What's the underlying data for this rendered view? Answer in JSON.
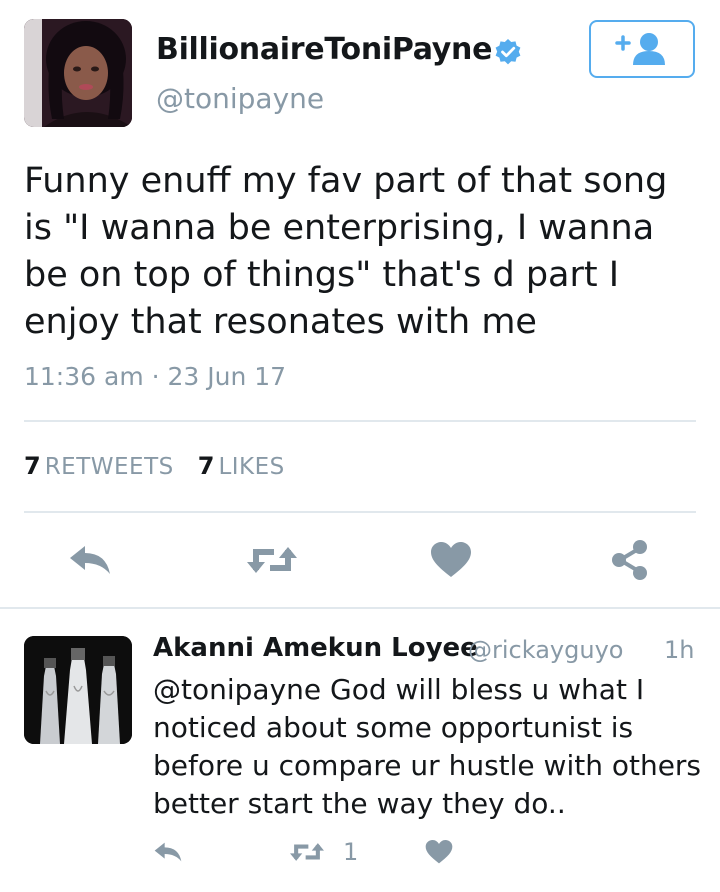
{
  "tweet": {
    "display_name": "BillionaireToniPayne",
    "handle": "@tonipayne",
    "text": "Funny enuff my fav part of that song is \"I wanna be enterprising, I wanna be on top of things\" that's d part I enjoy that resonates with me",
    "timestamp": "11:36 am · 23 Jun 17",
    "retweet_count": "7",
    "retweet_label": "RETWEETS",
    "like_count": "7",
    "like_label": "LIKES"
  },
  "reply": {
    "display_name": "Akanni Amekun Loyee",
    "handle": "@rickayguyo",
    "time": "1h",
    "text": "@tonipayne God will bless u what I noticed about some opportunist is before u compare ur hustle with others better start the way they do..",
    "retweet_count": "1"
  },
  "icons": {
    "verified": "verified-badge-icon",
    "follow": "add-user-icon",
    "reply": "reply-icon",
    "retweet": "retweet-icon",
    "like": "heart-icon",
    "share": "share-icon"
  },
  "colors": {
    "accent": "#55acee",
    "icon_gray": "#8899a6",
    "text": "#14171a",
    "divider": "#e1e8ed"
  }
}
